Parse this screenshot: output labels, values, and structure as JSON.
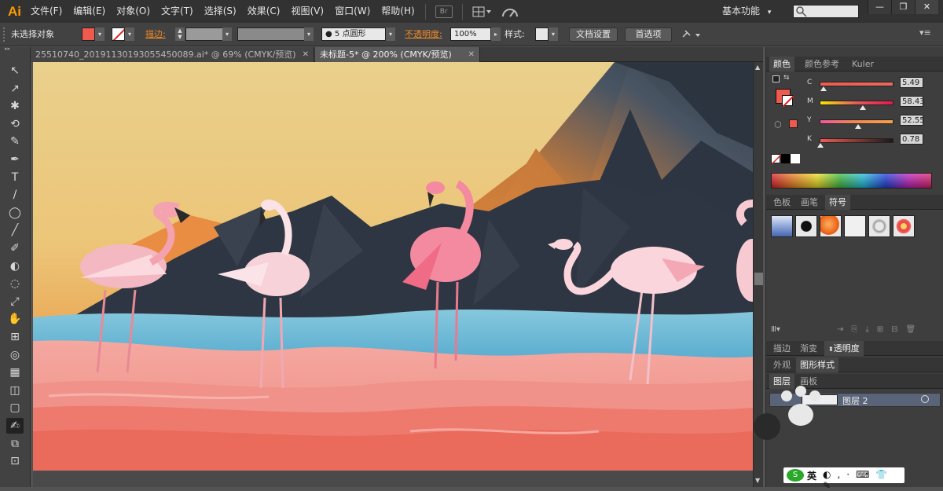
{
  "app": {
    "logo": "Ai"
  },
  "menu": [
    "文件(F)",
    "编辑(E)",
    "对象(O)",
    "文字(T)",
    "选择(S)",
    "效果(C)",
    "视图(V)",
    "窗口(W)",
    "帮助(H)"
  ],
  "toolbar_extra": {
    "bridge_label": "Br"
  },
  "workspace": {
    "label": "基本功能",
    "arrow": "▾"
  },
  "window_buttons": [
    "—",
    "❐",
    "✕"
  ],
  "control_bar": {
    "selection_label": "未选择对象",
    "stroke_label": "描边:",
    "brush_value": "5 点圆形",
    "opacity_label": "不透明度:",
    "opacity_value": "100%",
    "style_label": "样式:",
    "doc_settings": "文档设置",
    "prefs": "首选项"
  },
  "doc_tabs": [
    {
      "title": "25510740_20191130193055450089.ai* @ 69% (CMYK/预览)",
      "close": "✕"
    },
    {
      "title": "未标题-5* @ 200% (CMYK/预览)",
      "close": "✕"
    }
  ],
  "tools": [
    "↖",
    "↗",
    "✱",
    "⟲",
    "✎",
    "✒",
    "T",
    "/",
    "◯",
    "╱",
    "✐",
    "◐",
    "◌",
    "⤢",
    "✋",
    "⊞",
    "◎",
    "▦",
    "◫",
    "▢",
    "✍",
    "⧉",
    "⊡"
  ],
  "color_panel": {
    "tabs": [
      "颜色",
      "颜色参考",
      "Kuler"
    ],
    "sliders": [
      {
        "letter": "C",
        "value": "5.49",
        "pos": 0.055,
        "gradient": "linear-gradient(to right,#ef5a52,#e96a5e)"
      },
      {
        "letter": "M",
        "value": "58.43",
        "pos": 0.584,
        "gradient": "linear-gradient(to right,#f4e600,#e85a5a,#e4184f)"
      },
      {
        "letter": "Y",
        "value": "52.55",
        "pos": 0.525,
        "gradient": "linear-gradient(to right,#ef5a9a,#ef8a50,#f3a24e)"
      },
      {
        "letter": "K",
        "value": "0.78",
        "pos": 0.008,
        "gradient": "linear-gradient(to right,#ef5a52,#1a1a1a)"
      }
    ],
    "fill_color": "#ef5a4f"
  },
  "swatch_panel": {
    "tabs": [
      "色板",
      "画笔",
      "符号"
    ]
  },
  "mid_panel_tabs": [
    "描边",
    "渐变",
    "透明度"
  ],
  "appearance_tabs": [
    "外观",
    "图形样式"
  ],
  "layers_panel": {
    "tabs": [
      "图层",
      "画板"
    ],
    "layer_name": "图层 2"
  },
  "ime_bar": {
    "label": "英"
  }
}
